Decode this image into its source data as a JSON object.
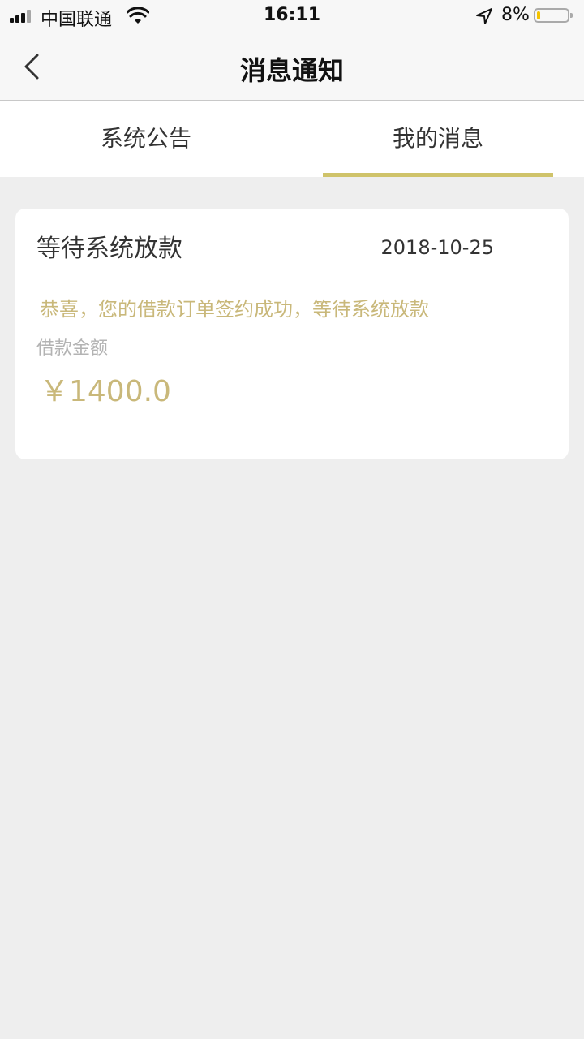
{
  "status_bar": {
    "carrier": "中国联通",
    "time": "16:11",
    "battery_percent": "8%",
    "battery_level": 0.08,
    "icons": [
      "signal-icon",
      "wifi-icon",
      "location-arrow-icon",
      "battery-icon"
    ]
  },
  "header": {
    "title": "消息通知",
    "back_icon": "chevron-left-icon"
  },
  "tabs": [
    {
      "label": "系统公告",
      "active": false
    },
    {
      "label": "我的消息",
      "active": true
    }
  ],
  "colors": {
    "accent": "#cfc36a",
    "message_text": "#c9b87a",
    "background": "#eeeeee"
  },
  "messages": [
    {
      "title": "等待系统放款",
      "date": "2018-10-25",
      "body": "恭喜，您的借款订单签约成功，等待系统放款",
      "amount_label": "借款金额",
      "amount": "￥1400.0"
    }
  ]
}
